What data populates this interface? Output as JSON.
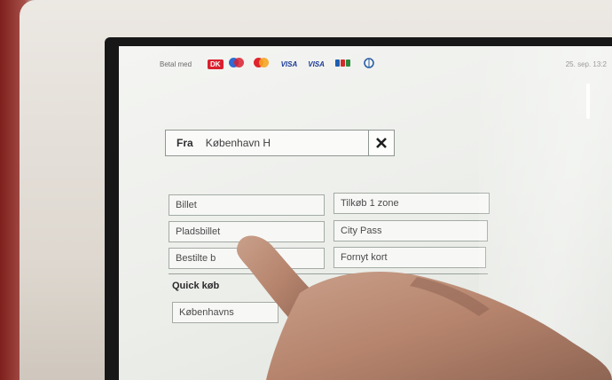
{
  "status_bar": {
    "pay_label": "Betal med",
    "card_logos": [
      "DK",
      "VISA",
      "VISA"
    ],
    "datetime": "25. sep.  13:2"
  },
  "from": {
    "label": "Fra",
    "value": "København H",
    "clear_icon": "close-icon"
  },
  "ticket_options": {
    "left": [
      {
        "label": "Billet"
      },
      {
        "label": "Pladsbillet"
      },
      {
        "label": "Bestilte b"
      }
    ],
    "right": [
      {
        "label": "Tilkøb 1 zone"
      },
      {
        "label": "City Pass"
      },
      {
        "label": "Fornyt kort"
      }
    ]
  },
  "quick_buy": {
    "label": "Quick køb",
    "items": [
      {
        "label": "Københavns"
      }
    ]
  },
  "colors": {
    "screen_bg": "#eef0ec",
    "button_border": "#a3aaa4",
    "kiosk_red": "#8e2a25"
  }
}
